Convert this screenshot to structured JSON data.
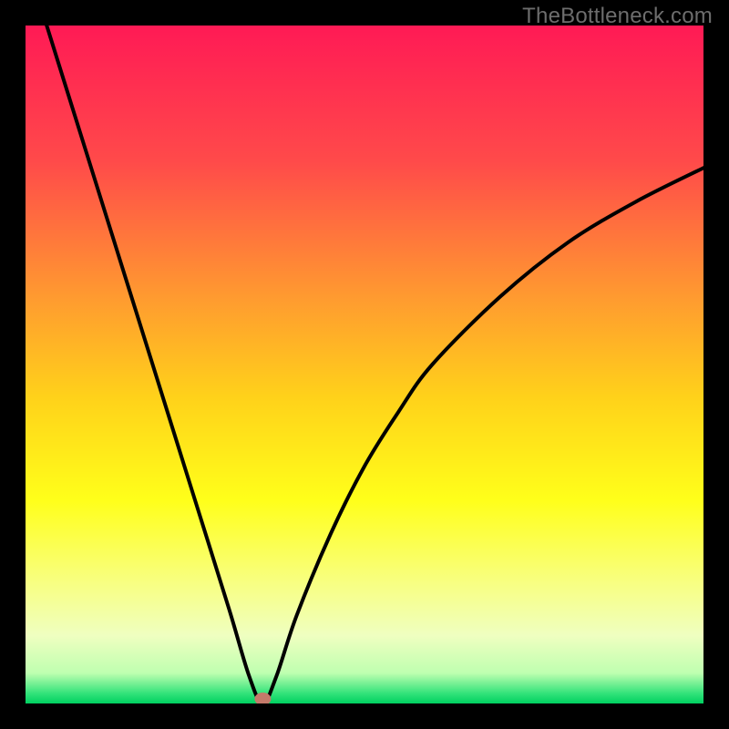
{
  "watermark": {
    "text": "TheBottleneck.com"
  },
  "chart_data": {
    "type": "line",
    "title": "",
    "xlabel": "",
    "ylabel": "",
    "xlim": [
      0,
      100
    ],
    "ylim": [
      0,
      100
    ],
    "grid": false,
    "legend": false,
    "series": [
      {
        "name": "bottleneck-curve",
        "x": [
          0,
          5,
          10,
          15,
          20,
          25,
          30,
          33,
          35,
          37,
          40,
          45,
          50,
          55,
          60,
          70,
          80,
          90,
          100
        ],
        "values": [
          110,
          94,
          78,
          62,
          46,
          30,
          14,
          4,
          0,
          4,
          13,
          25,
          35,
          43,
          50,
          60,
          68,
          74,
          79
        ]
      }
    ],
    "marker": {
      "x": 35,
      "y": 0
    },
    "background_gradient": {
      "stops": [
        {
          "pos": 0.0,
          "color": "#ff1a55"
        },
        {
          "pos": 0.2,
          "color": "#ff4a4a"
        },
        {
          "pos": 0.4,
          "color": "#ff9a30"
        },
        {
          "pos": 0.55,
          "color": "#ffd21a"
        },
        {
          "pos": 0.7,
          "color": "#ffff1a"
        },
        {
          "pos": 0.82,
          "color": "#f8ff80"
        },
        {
          "pos": 0.9,
          "color": "#efffc0"
        },
        {
          "pos": 0.955,
          "color": "#bfffb0"
        },
        {
          "pos": 0.985,
          "color": "#33e37a"
        },
        {
          "pos": 1.0,
          "color": "#00d060"
        }
      ]
    }
  }
}
